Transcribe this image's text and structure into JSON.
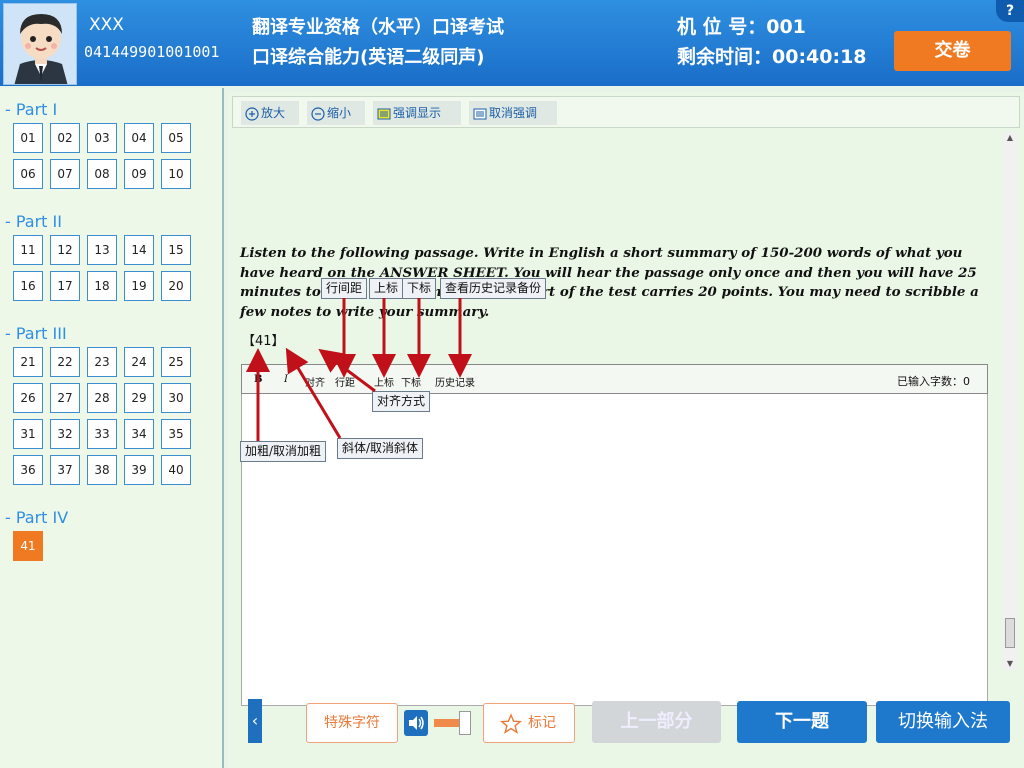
{
  "header": {
    "candidate_name": "XXX",
    "candidate_id": "041449901001001",
    "exam_title": "翻译专业资格（水平）口译考试",
    "exam_subtitle": "口译综合能力(英语二级同声)",
    "seat_label": "机 位 号：001",
    "time_label": "剩余时间：00:40:18",
    "submit_label": "交卷",
    "help_label": "?"
  },
  "parts": [
    {
      "title": "- Part I",
      "questions": [
        "01",
        "02",
        "03",
        "04",
        "05",
        "06",
        "07",
        "08",
        "09",
        "10"
      ]
    },
    {
      "title": "- Part II",
      "questions": [
        "11",
        "12",
        "13",
        "14",
        "15",
        "16",
        "17",
        "18",
        "19",
        "20"
      ]
    },
    {
      "title": "- Part III",
      "questions": [
        "21",
        "22",
        "23",
        "24",
        "25",
        "26",
        "27",
        "28",
        "29",
        "30",
        "31",
        "32",
        "33",
        "34",
        "35",
        "36",
        "37",
        "38",
        "39",
        "40"
      ]
    },
    {
      "title": "- Part IV",
      "questions": [
        "41"
      ]
    }
  ],
  "active_question": "41",
  "toolbar": {
    "zoom_in": "放大",
    "zoom_out": "缩小",
    "highlight": "强调显示",
    "unhighlight": "取消强调"
  },
  "instructions": "Listen to the following passage. Write in English a short summary of 150-200 words of what you have heard on the ANSWER SHEET. You will hear the passage only once and then you will have 25 minutes to finish your summary. This part of the test carries 20 points. You may need to scribble a few notes to write your summary.",
  "question_number": "【41】",
  "editor": {
    "bold": "B",
    "italic": "I",
    "align": "对齐",
    "line_spacing": "行距",
    "superscript": "上标",
    "subscript": "下标",
    "history": "历史记录",
    "char_count": "已输入字数：0"
  },
  "callouts": {
    "line_spacing": "行间距",
    "superscript": "上标",
    "subscript": "下标",
    "history": "查看历史记录备份",
    "align": "对齐方式",
    "italic": "斜体/取消斜体",
    "bold": "加粗/取消加粗"
  },
  "bottom": {
    "prev_arrow": "‹",
    "special_chars": "特殊字符",
    "mark": "标记",
    "prev_part": "上一部分",
    "next_question": "下一题",
    "switch_ime": "切换输入法"
  },
  "volume": 0.85,
  "colors": {
    "header_blue": "#1a6ec8",
    "accent_orange": "#f07a22",
    "button_blue": "#1e78cc",
    "annotation_red": "#c0101a"
  }
}
